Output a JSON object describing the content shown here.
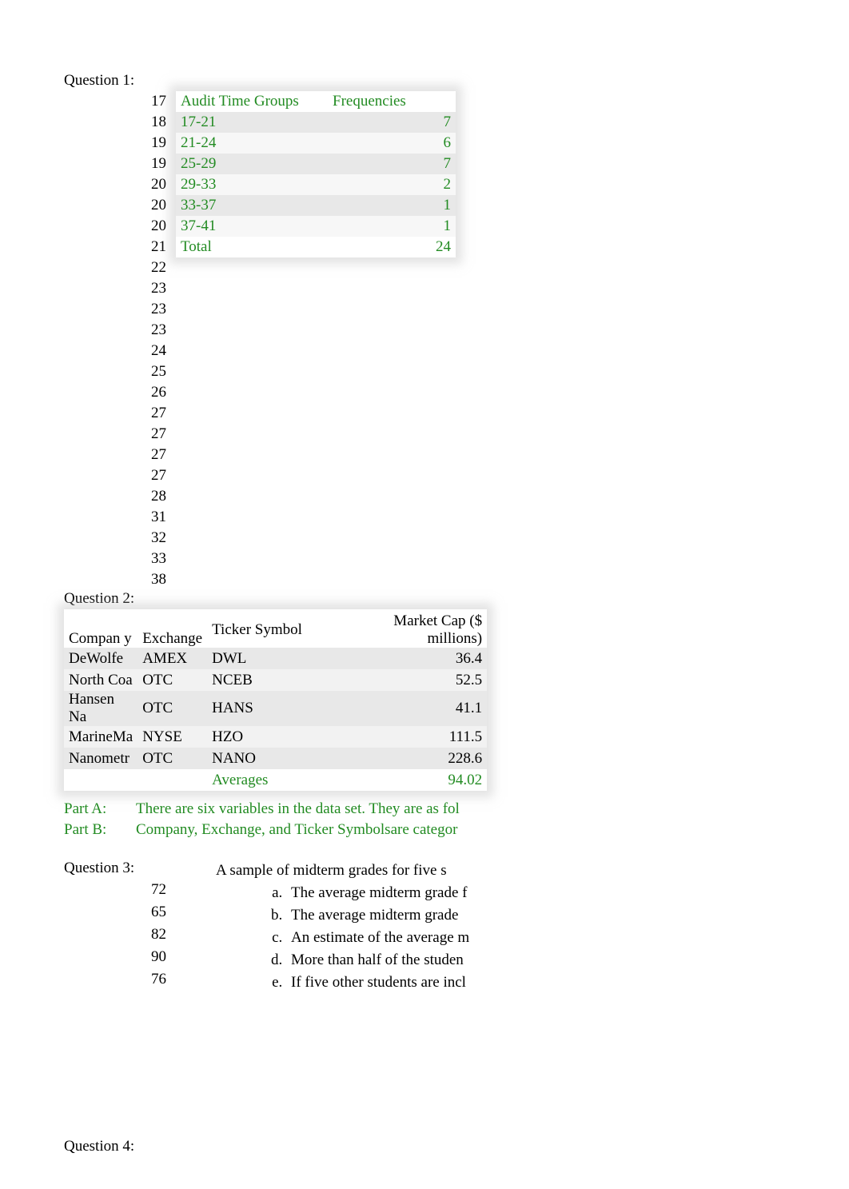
{
  "q1": {
    "label": "Question 1:",
    "numbers": [
      "17",
      "18",
      "19",
      "19",
      "20",
      "20",
      "20",
      "21",
      "22",
      "23",
      "23",
      "23",
      "24",
      "25",
      "26",
      "27",
      "27",
      "27",
      "27",
      "28",
      "31",
      "32",
      "33",
      "38"
    ],
    "freq": {
      "headers": {
        "a": "Audit Time Groups",
        "b": "Frequencies"
      },
      "rows": [
        {
          "a": "17-21",
          "b": "7"
        },
        {
          "a": "21-24",
          "b": "6"
        },
        {
          "a": "25-29",
          "b": "7"
        },
        {
          "a": "29-33",
          "b": "2"
        },
        {
          "a": "33-37",
          "b": "1"
        },
        {
          "a": "37-41",
          "b": "1"
        }
      ],
      "total": {
        "a": "Total",
        "b": "24"
      }
    }
  },
  "q2": {
    "label": "Question 2:",
    "headers": {
      "company": "Compan\ny",
      "exchange": "Exchange",
      "ticker": "Ticker Symbol",
      "mcap": "Market Cap ($ millions)"
    },
    "rows": [
      {
        "company": "DeWolfe",
        "exchange": "AMEX",
        "ticker": "DWL",
        "mcap": "36.4"
      },
      {
        "company": "North Coa",
        "exchange": "OTC",
        "ticker": "NCEB",
        "mcap": "52.5"
      },
      {
        "company": "Hansen Na",
        "exchange": "OTC",
        "ticker": "HANS",
        "mcap": "41.1"
      },
      {
        "company": "MarineMa",
        "exchange": "NYSE",
        "ticker": "HZO",
        "mcap": "111.5"
      },
      {
        "company": "Nanometr",
        "exchange": "OTC",
        "ticker": "NANO",
        "mcap": "228.6"
      }
    ],
    "averages": {
      "label": "Averages",
      "value": "94.02"
    },
    "partA": {
      "label": "Part A:",
      "text": "There are six variables in the data set. They are as fol"
    },
    "partB": {
      "label": "Part B:",
      "text": "Company, Exchange, and Ticker Symbolsare categor"
    }
  },
  "q3": {
    "label": "Question 3:",
    "numbers": [
      "72",
      "65",
      "82",
      "90",
      "76"
    ],
    "intro": "A sample of midterm grades for five s",
    "items": [
      "The average midterm grade f",
      "The average midterm grade",
      "An estimate of the average m",
      "More than half of the studen",
      "If five other students are incl"
    ]
  },
  "q4": {
    "label": "Question 4:"
  }
}
